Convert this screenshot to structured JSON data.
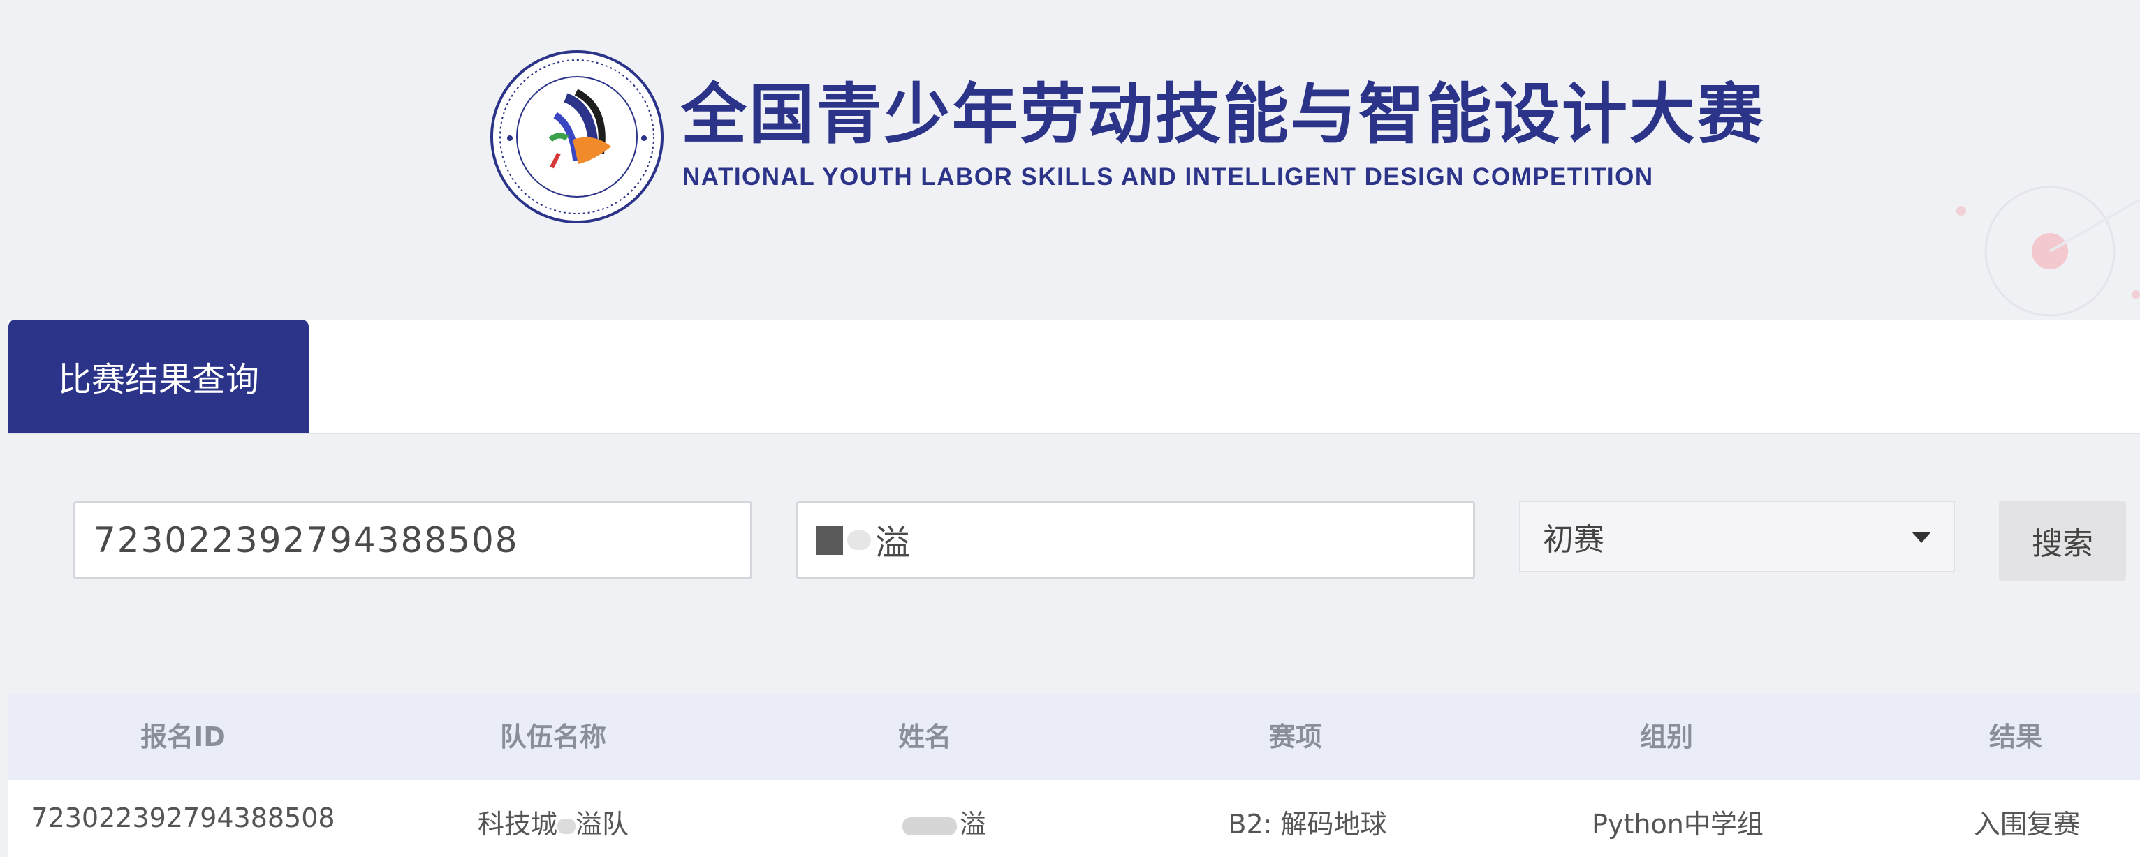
{
  "header": {
    "title_cn": "全国青少年劳动技能与智能设计大赛",
    "title_en": "NATIONAL YOUTH LABOR SKILLS AND  INTELLIGENT DESIGN COMPETITION",
    "logo_icon": "competition-emblem-icon"
  },
  "tabs": [
    {
      "label": "比赛结果查询",
      "active": true
    }
  ],
  "search": {
    "registration_id_value": "723022392794388508",
    "name_value_visible": "溢",
    "stage_selected": "初赛",
    "button_label": "搜索"
  },
  "table": {
    "headers": [
      "报名ID",
      "队伍名称",
      "姓名",
      "赛项",
      "组别",
      "结果"
    ],
    "rows": [
      {
        "registration_id": "723022392794388508",
        "team_prefix": "科技城",
        "team_suffix": "溢队",
        "name_visible": "溢",
        "event": "B2: 解码地球",
        "group": "Python中学组",
        "result": "入围复赛"
      }
    ]
  },
  "colors": {
    "brand": "#2b3489",
    "background": "#f0f1f5",
    "header_row": "#eaedf6"
  }
}
